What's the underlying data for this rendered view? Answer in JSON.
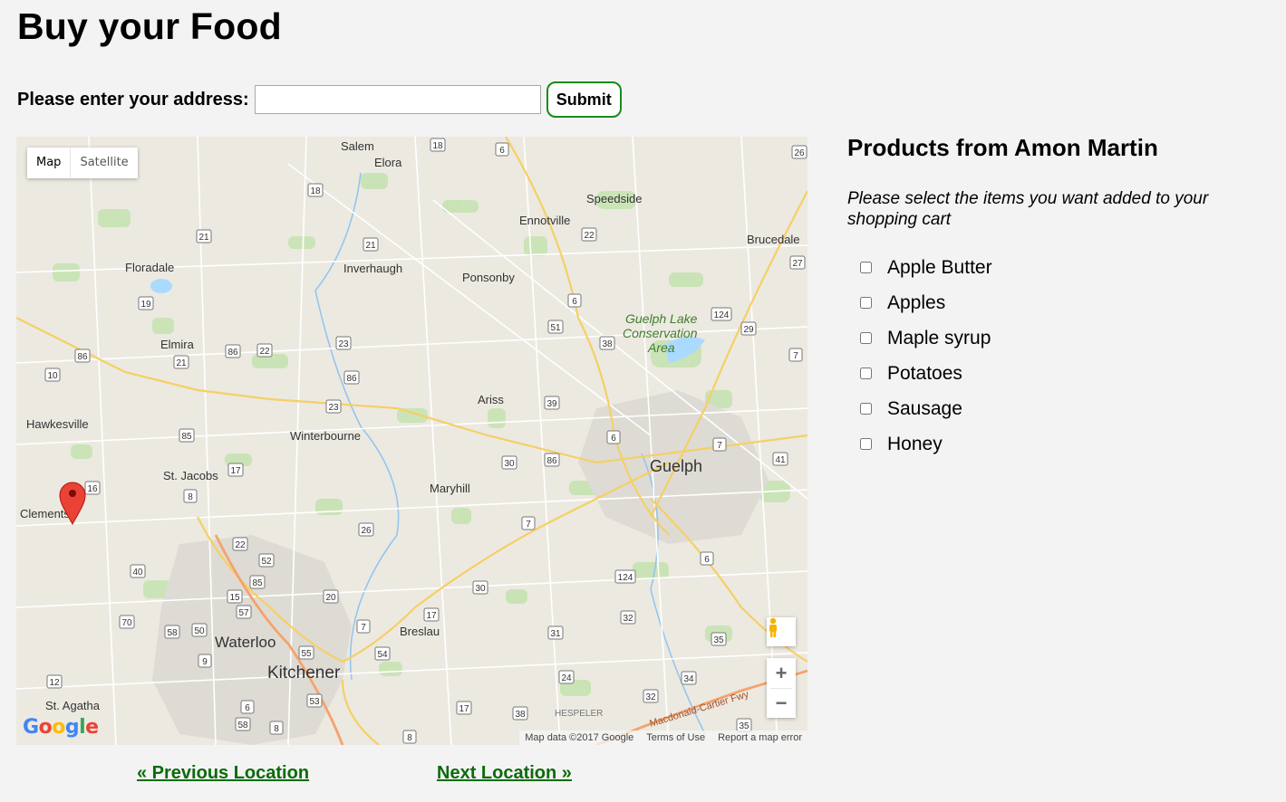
{
  "page": {
    "title": "Buy your Food"
  },
  "address_form": {
    "label": "Please enter your address:",
    "value": "",
    "placeholder": "",
    "submit_label": "Submit"
  },
  "map": {
    "type_controls": {
      "map_label": "Map",
      "satellite_label": "Satellite",
      "active": "Map"
    },
    "logo": "Google",
    "attribution": {
      "data": "Map data ©2017 Google",
      "terms": "Terms of Use",
      "report": "Report a map error"
    },
    "zoom": {
      "in": "+",
      "out": "−"
    },
    "places": [
      "Salem",
      "Elora",
      "Speedside",
      "Ennotville",
      "Bruce dale",
      "Floradale",
      "Inverhaugh",
      "Ponsonby",
      "Guelph Lake Conservation Area",
      "Elmira",
      "Ariss",
      "Hawkesville",
      "Winterbourne",
      "St. Jacobs",
      "Guelph",
      "Maryhill",
      "Clements",
      "Breslau",
      "Waterloo",
      "Kitchener",
      "St. Agatha",
      "HESPELER",
      "Macdonald-Cartier Fwy"
    ],
    "route_shields": [
      "18",
      "6",
      "26",
      "18",
      "22",
      "21",
      "27",
      "21",
      "19",
      "124",
      "6",
      "51",
      "38",
      "29",
      "7",
      "86",
      "86",
      "22",
      "23",
      "21",
      "10",
      "86",
      "23",
      "39",
      "85",
      "6",
      "7",
      "30",
      "86",
      "41",
      "17",
      "16",
      "8",
      "7",
      "26",
      "22",
      "52",
      "40",
      "124",
      "6",
      "85",
      "15",
      "20",
      "30",
      "57",
      "17",
      "70",
      "7",
      "32",
      "58",
      "50",
      "31",
      "9",
      "55",
      "54",
      "35",
      "12",
      "24",
      "34",
      "6",
      "53",
      "17",
      "32",
      "58",
      "8",
      "8",
      "38",
      "35"
    ],
    "marker": {
      "color": "#ea4335"
    }
  },
  "panel": {
    "heading": "Products from Amon Martin",
    "instructions": "Please select the items you want added to your shopping cart",
    "products": [
      {
        "label": "Apple Butter",
        "checked": false
      },
      {
        "label": "Apples",
        "checked": false
      },
      {
        "label": "Maple syrup",
        "checked": false
      },
      {
        "label": "Potatoes",
        "checked": false
      },
      {
        "label": "Sausage",
        "checked": false
      },
      {
        "label": "Honey",
        "checked": false
      }
    ]
  },
  "pager": {
    "previous": "« Previous Location ",
    "next": "Next Location »"
  },
  "colors": {
    "background": "#f3f3f3",
    "link": "#0a6b0a",
    "submit_border": "#1a8a1a"
  }
}
